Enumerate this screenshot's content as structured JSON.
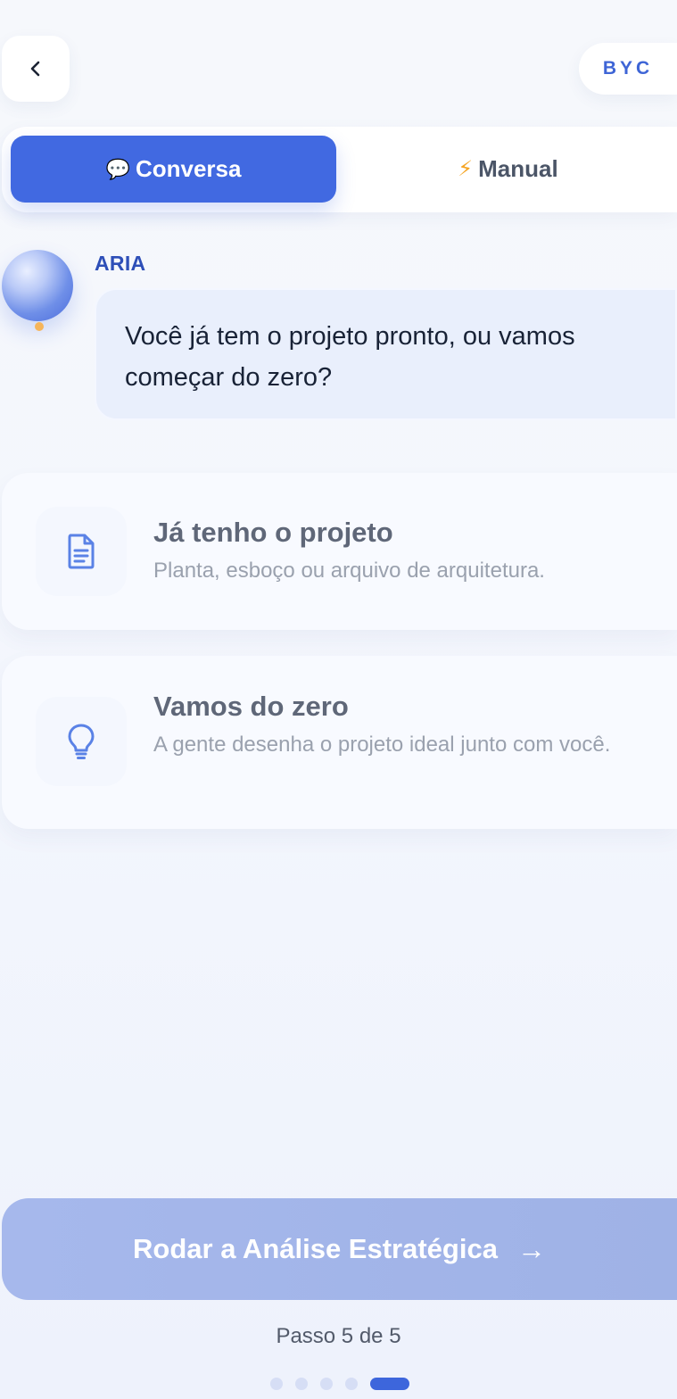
{
  "header": {
    "back_icon": "chevron-left-icon",
    "brand": "BYC"
  },
  "mode_tabs": [
    {
      "icon": "💬",
      "label": "Conversa",
      "active": true
    },
    {
      "icon": "⚡",
      "label": "Manual",
      "active": false
    }
  ],
  "assistant": {
    "name": "ARIA",
    "message": "Você já tem o projeto pronto, ou vamos começar do zero?"
  },
  "options": [
    {
      "icon": "document-icon",
      "title": "Já tenho o projeto",
      "subtitle": "Planta, esboço ou arquivo de arquitetura."
    },
    {
      "icon": "lightbulb-icon",
      "title": "Vamos do zero",
      "subtitle": "A gente desenha o projeto ideal junto com você."
    }
  ],
  "cta": {
    "label": "Rodar a Análise Estratégica",
    "arrow": "→"
  },
  "progress": {
    "label": "Passo 5 de 5",
    "current": 5,
    "total": 5
  },
  "colors": {
    "accent": "#4169e1",
    "bubble_bg": "#e9effc",
    "cta_disabled": "#a6b8ec",
    "bolt": "#f5a524"
  }
}
